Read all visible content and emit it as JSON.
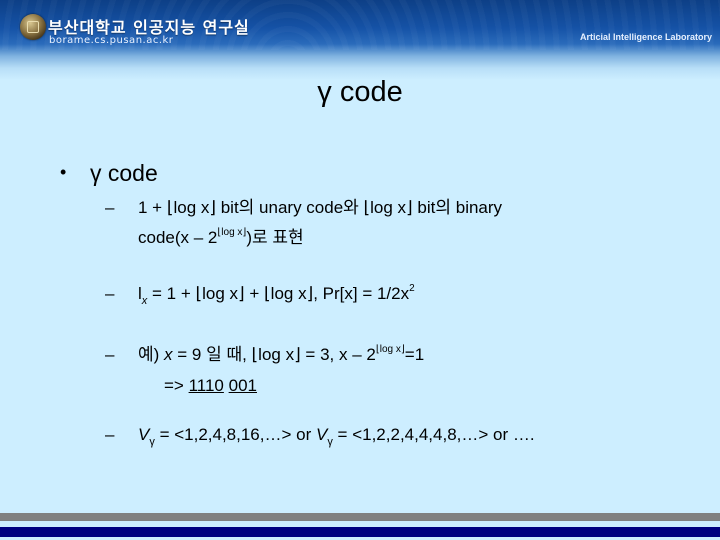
{
  "header": {
    "university_title": "부산대학교 인공지능 연구실",
    "url_text": "borame.cs.pusan.ac.kr",
    "lab_name": "Articial Intelligence Laboratory",
    "logo_icon": "university-seal-icon"
  },
  "slide": {
    "title": "γ code",
    "bullet": {
      "marker": "•",
      "text": "γ code"
    },
    "items": [
      {
        "marker": "–",
        "line1": "1 + ⌊log x⌋ bit의 unary code와 ⌊log x⌋ bit의 binary",
        "line2_pre": "code(x – 2",
        "line2_sup": "⌊log x⌋",
        "line2_post": ")로 표현"
      },
      {
        "marker": "–",
        "l_symbol": "l",
        "l_sub": "x",
        "formula": " = 1 + ⌊log x⌋ + ⌊log x⌋, Pr[x] = 1/2x",
        "formula_sup": "2"
      },
      {
        "marker": "–",
        "pre": "예) ",
        "x_var": "x",
        "mid": " = 9 일 때, ⌊log x⌋ = 3, x – 2",
        "sup": "⌊log x⌋",
        "post": "=1",
        "result_arrow": "=> ",
        "result_unary": "1110",
        "result_binary": "001"
      },
      {
        "marker": "–",
        "v_symbol": "V",
        "v_sub": "γ",
        "seq1": " = <1,2,4,8,16,…>  or  ",
        "seq2": " = <1,2,2,4,4,4,8,…> or ….",
        "v2_symbol": "V",
        "v2_sub": "γ"
      }
    ]
  },
  "footer": {
    "bar_gray_color": "#808080",
    "bar_navy_color": "#000080"
  },
  "colors": {
    "background": "#cdeeff",
    "header_blue": "#1552a6"
  }
}
